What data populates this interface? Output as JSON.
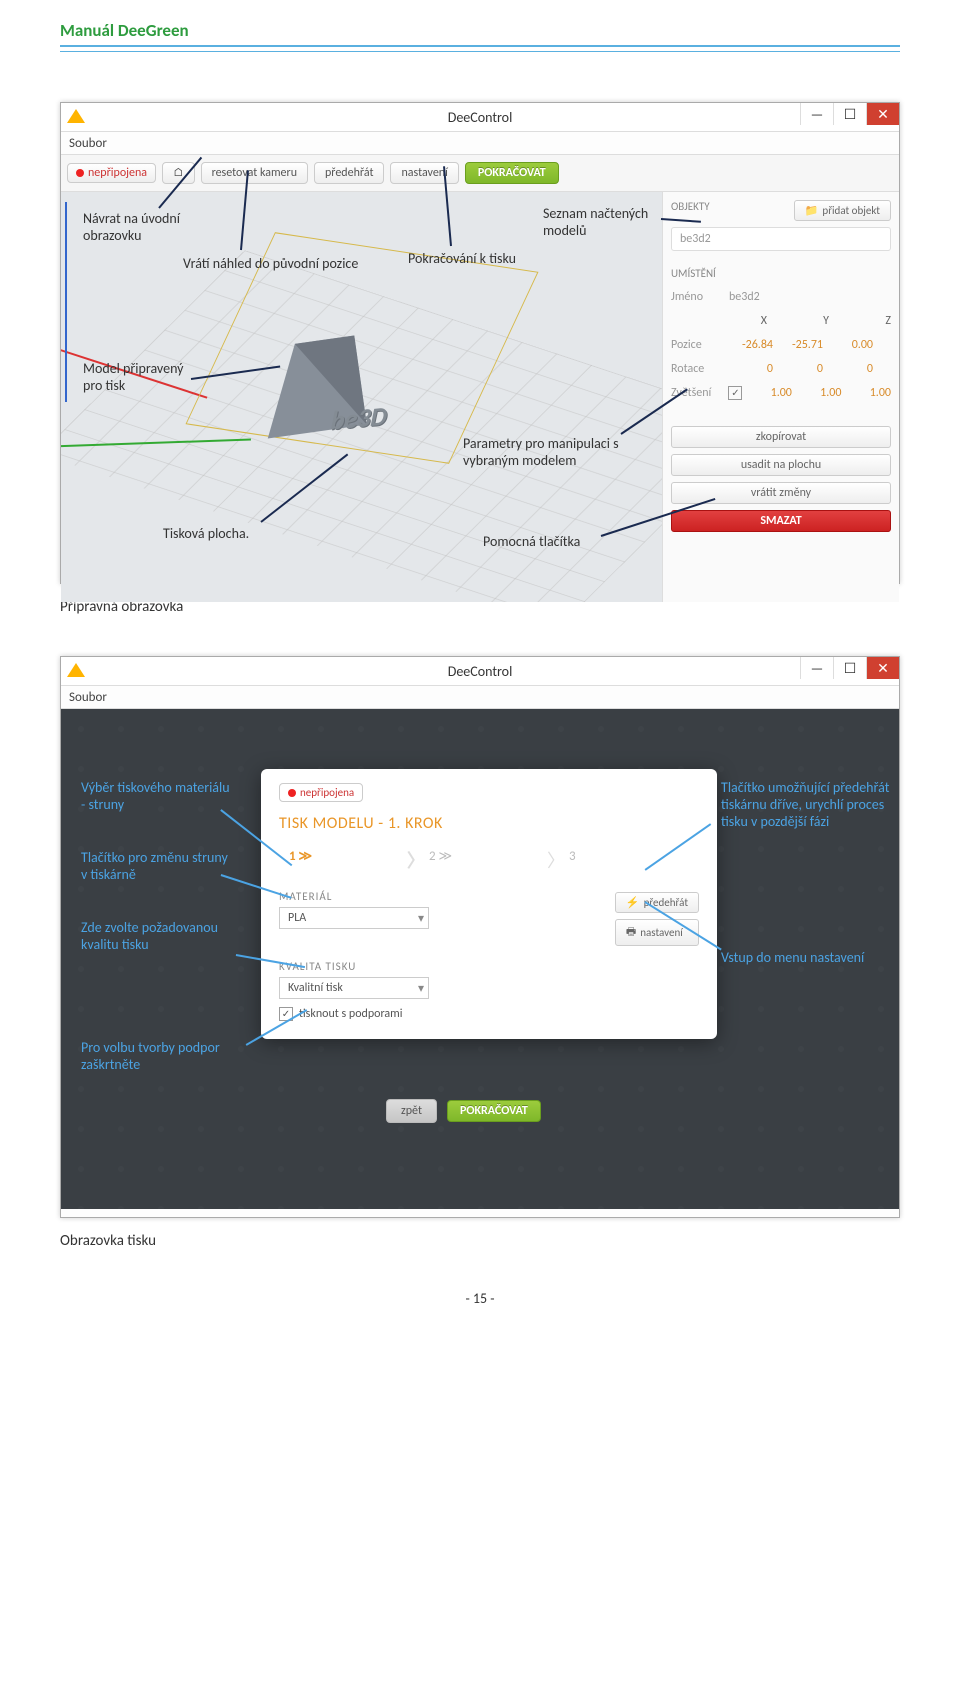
{
  "doc_title": "Manuál DeeGreen",
  "screenshot1": {
    "window_title": "DeeControl",
    "menu": "Soubor",
    "toolbar": {
      "status": "nepřipojena",
      "reset_cam": "resetovat kameru",
      "preheat": "předehřát",
      "settings": "nastavení",
      "continue": "POKRAČOVAT"
    },
    "side": {
      "objects_label": "OBJEKTY",
      "add_object": "přidat objekt",
      "obj_name": "be3d2",
      "placement_label": "UMÍSTĚNÍ",
      "name_label": "Jméno",
      "name_value": "be3d2",
      "X": "X",
      "Y": "Y",
      "Z": "Z",
      "pos_label": "Pozice",
      "pos_x": "-26.84",
      "pos_y": "-25.71",
      "pos_z": "0.00",
      "rot_label": "Rotace",
      "rot_x": "0",
      "rot_y": "0",
      "rot_z": "0",
      "scale_label": "Zvětšení",
      "scale_x": "1.00",
      "scale_y": "1.00",
      "scale_z": "1.00",
      "copy": "zkopírovat",
      "seat": "usadit na plochu",
      "revert": "vrátit změny",
      "delete": "SMAZAT"
    },
    "model_text": "be3D",
    "annot": {
      "a1": "Návrat na úvodní obrazovku",
      "a2": "Vrátí náhled do původní pozice",
      "a3": "Pokračování k tisku",
      "a4": "Seznam načtených modelů",
      "a5": "Model připravený pro tisk",
      "a6": "Parametry pro manipulaci s vybraným modelem",
      "a7": "Tisková plocha.",
      "a8": "Pomocná tlačítka"
    }
  },
  "caption1": "Přípravná obrazovka",
  "screenshot2": {
    "window_title": "DeeControl",
    "menu": "Soubor",
    "status": "nepřipojena",
    "modal_title": "TISK MODELU - 1. KROK",
    "step1": "1",
    "step2": "2",
    "step3": "3",
    "material_label": "MATERIÁL",
    "material_value": "PLA",
    "preheat_btn": "předehřát",
    "settings_btn": "nastavení",
    "quality_label": "KVALITA TISKU",
    "quality_value": "Kvalitní tisk",
    "supports_label": "tisknout s podporami",
    "back": "zpět",
    "continue": "POKRAČOVAT",
    "annot": {
      "b1": "Výběr tiskového materiálu - struny",
      "b2": "Tlačítko pro změnu struny v tiskárně",
      "b3": "Zde zvolte požadovanou kvalitu tisku",
      "b4": "Pro volbu tvorby podpor zaškrtněte",
      "b5": "Tlačítko umožňující předehřát tiskárnu dříve, urychlí proces tisku v pozdější fázi",
      "b6": "Vstup do menu nastavení"
    }
  },
  "caption2": "Obrazovka tisku",
  "footer": "- 15 -"
}
